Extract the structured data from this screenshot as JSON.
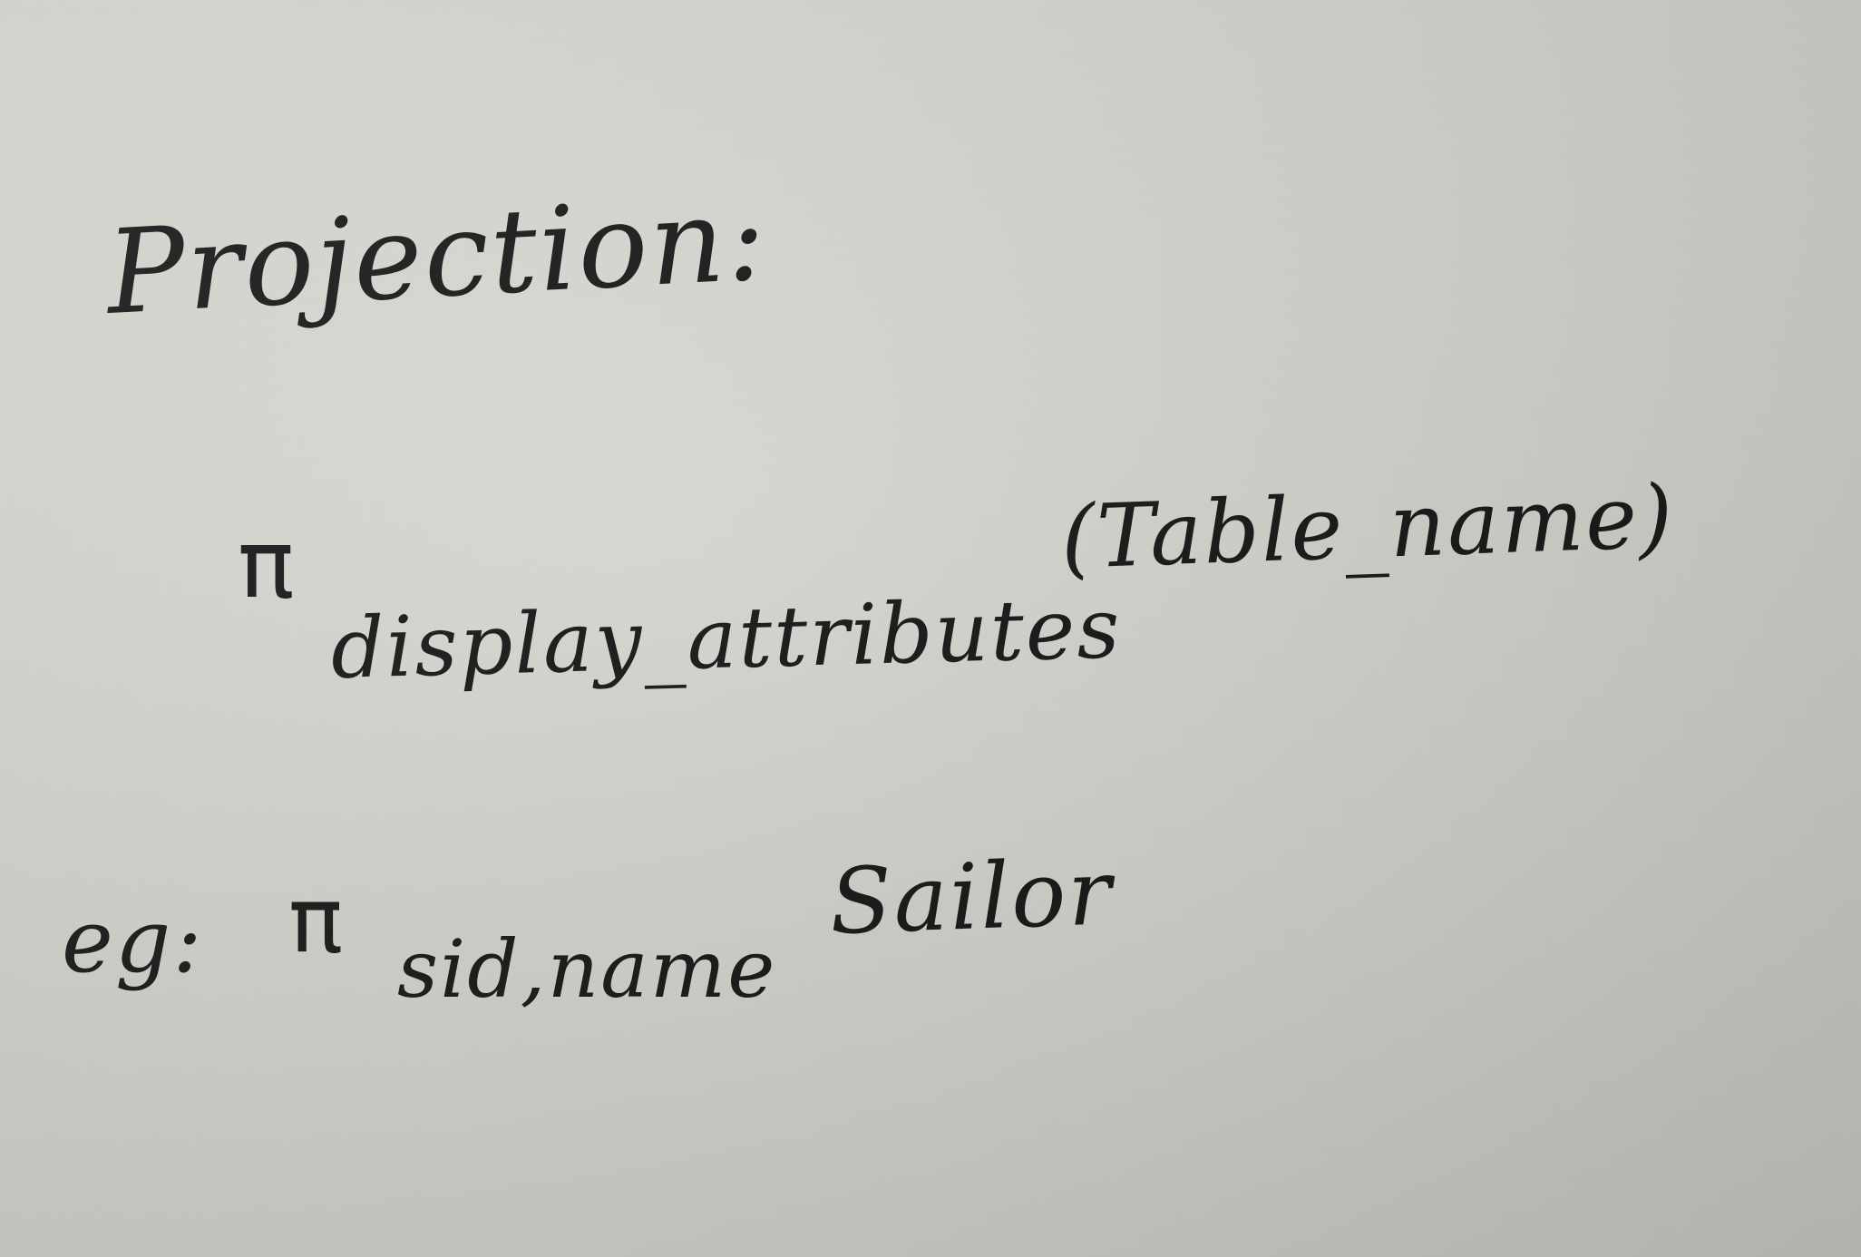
{
  "note": {
    "heading": "Projection:",
    "general_form": {
      "operator": "π",
      "subscript": "display_attributes",
      "argument": "(Table_name)"
    },
    "example": {
      "label": "eg:",
      "operator": "π",
      "subscript": "sid,name",
      "argument": "Sailor"
    }
  }
}
